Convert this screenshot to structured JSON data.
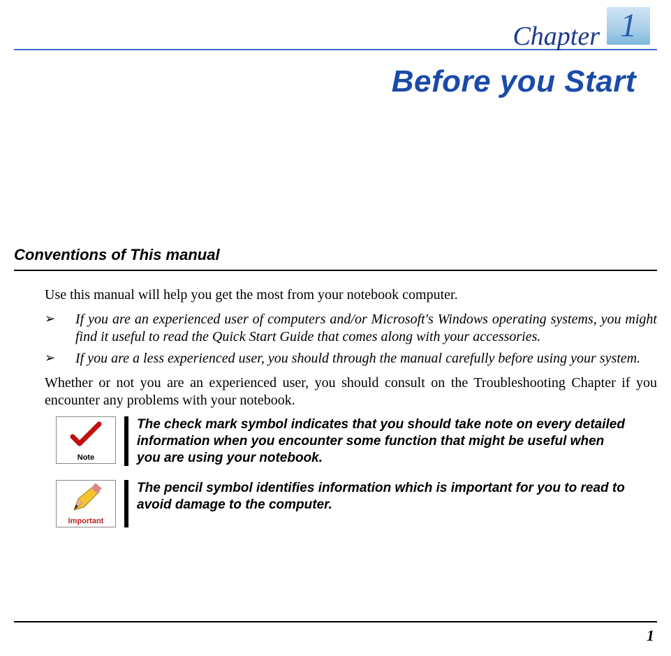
{
  "chapter": {
    "word": "Chapter",
    "number": "1",
    "title": "Before you Start"
  },
  "section_heading": "Conventions of This manual",
  "intro": "Use this manual will help you get the most from your notebook computer.",
  "bullets": [
    "If you are an experienced user of computers and/or Microsoft's Windows operating systems, you might find it useful to read the Quick Start Guide that comes along with your accessories.",
    "If you are a less experienced user, you should through the manual carefully before using your system."
  ],
  "mid_paragraph": "Whether or not you are an experienced user, you should consult on the Troubleshooting Chapter if you encounter any problems with your notebook.",
  "callouts": {
    "note": {
      "label": "Note",
      "text": "The check mark symbol indicates that you should take note on every detailed information when you encounter some function that might be useful when you are using your notebook."
    },
    "important": {
      "label": "Important",
      "text": "The pencil symbol identifies information which is important for you to read to avoid damage to the computer."
    }
  },
  "page_number": "1"
}
